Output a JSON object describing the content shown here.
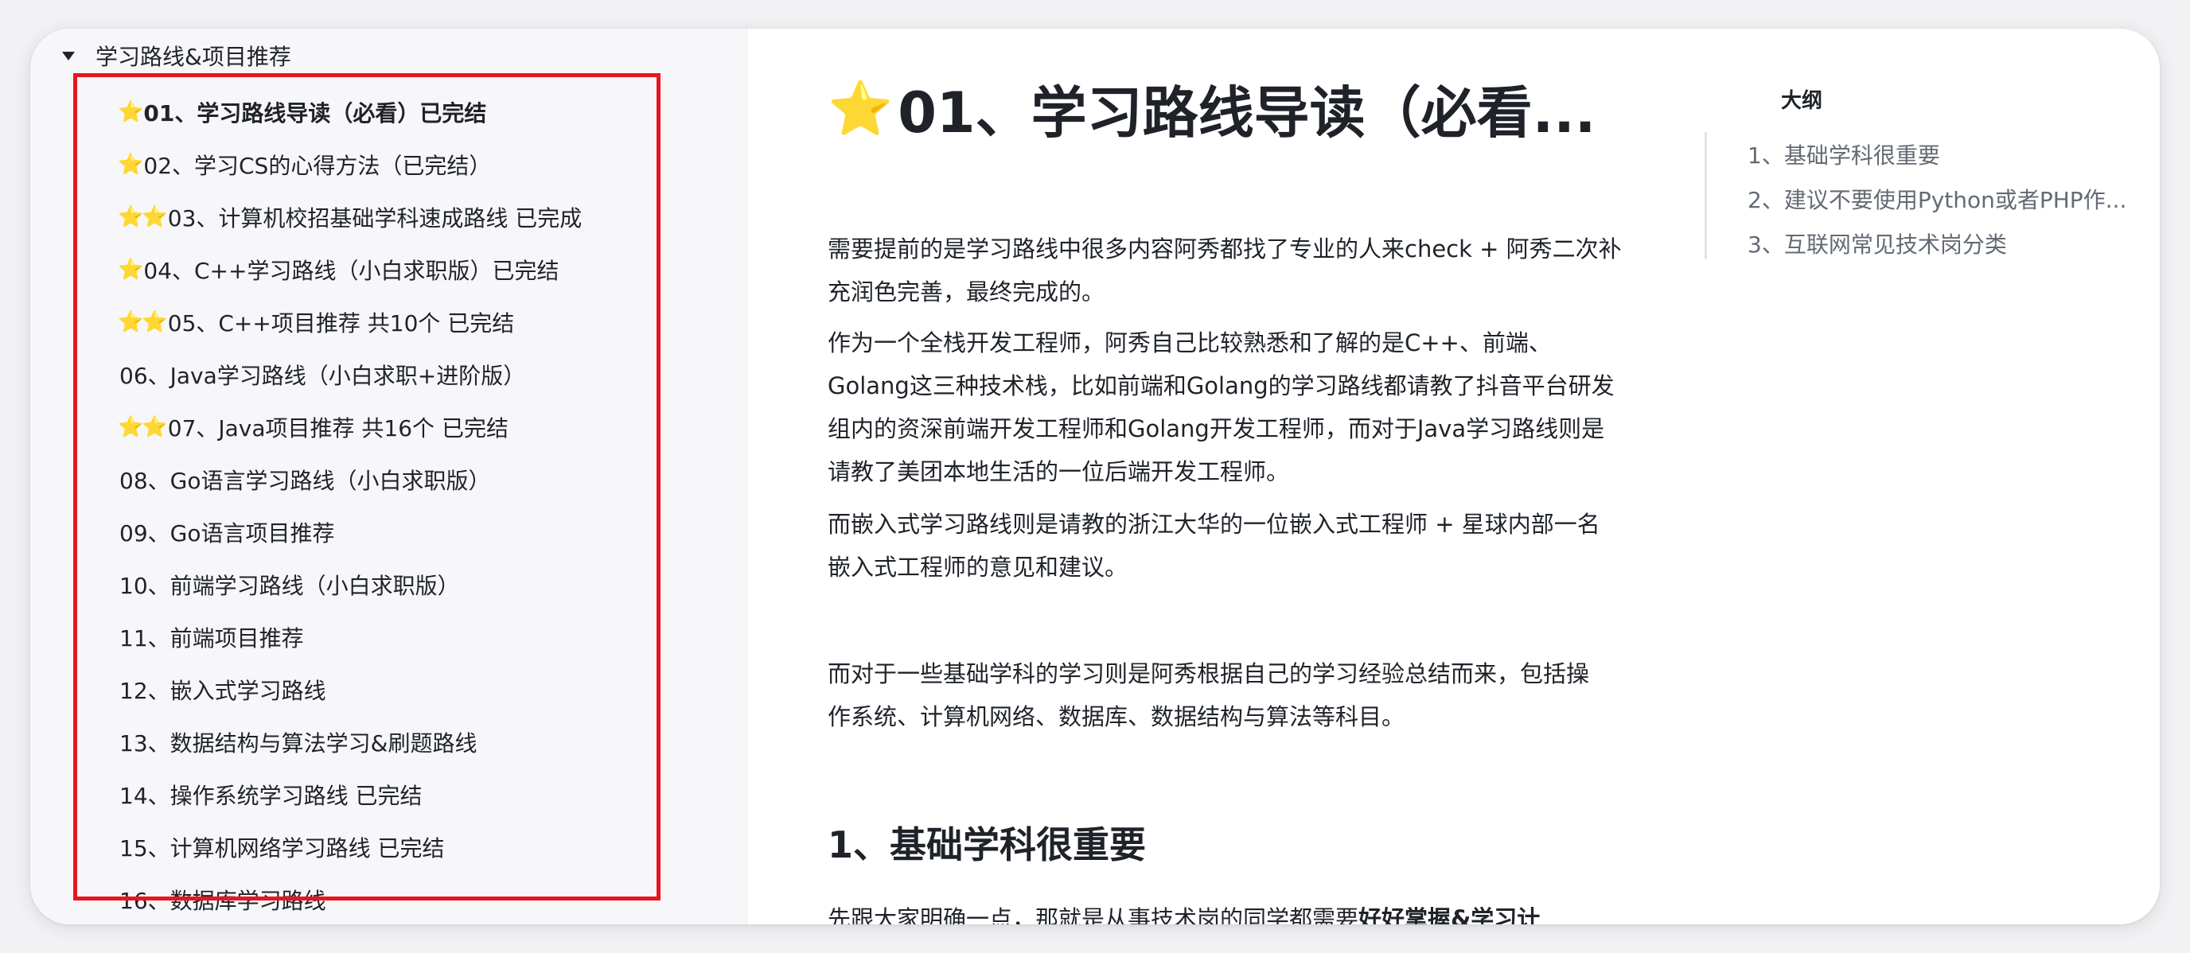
{
  "sidebar": {
    "folder_label": "学习路线&项目推荐",
    "items": [
      {
        "stars": "⭐",
        "label": "01、学习路线导读（必看）已完结",
        "active": true
      },
      {
        "stars": "⭐",
        "label": "02、学习CS的心得方法（已完结）"
      },
      {
        "stars": "⭐⭐",
        "label": "03、计算机校招基础学科速成路线 已完成"
      },
      {
        "stars": "⭐",
        "label": "04、C++学习路线（小白求职版）已完结"
      },
      {
        "stars": "⭐⭐",
        "label": "05、C++项目推荐 共10个 已完结"
      },
      {
        "stars": "",
        "label": "06、Java学习路线（小白求职+进阶版）"
      },
      {
        "stars": "⭐⭐",
        "label": "07、Java项目推荐 共16个 已完结"
      },
      {
        "stars": "",
        "label": "08、Go语言学习路线（小白求职版）"
      },
      {
        "stars": "",
        "label": "09、Go语言项目推荐"
      },
      {
        "stars": "",
        "label": "10、前端学习路线（小白求职版）"
      },
      {
        "stars": "",
        "label": "11、前端项目推荐"
      },
      {
        "stars": "",
        "label": "12、嵌入式学习路线"
      },
      {
        "stars": "",
        "label": "13、数据结构与算法学习&刷题路线"
      },
      {
        "stars": "",
        "label": "14、操作系统学习路线 已完结"
      },
      {
        "stars": "",
        "label": "15、计算机网络学习路线 已完结"
      },
      {
        "stars": "",
        "label": "16、数据库学习路线"
      }
    ]
  },
  "doc": {
    "title_star": "⭐",
    "title": "01、学习路线导读（必看...",
    "paragraphs": [
      [
        "需要提前的是学习路线中很多内容阿秀都找了专业的人来check + 阿秀二次补",
        "充润色完善，最终完成的。"
      ],
      [
        "作为一个全栈开发工程师，阿秀自己比较熟悉和了解的是C++、前端、",
        "Golang这三种技术栈，比如前端和Golang的学习路线都请教了抖音平台研发",
        "组内的资深前端开发工程师和Golang开发工程师，而对于Java学习路线则是",
        "请教了美团本地生活的一位后端开发工程师。"
      ],
      [
        "而嵌入式学习路线则是请教的浙江大华的一位嵌入式工程师 + 星球内部一名",
        "嵌入式工程师的意见和建议。"
      ],
      [
        "而对于一些基础学科的学习则是阿秀根据自己的学习经验总结而来，包括操",
        "作系统、计算机网络、数据库、数据结构与算法等科目。"
      ]
    ],
    "section_heading": "1、基础学科很重要",
    "cut_text_normal": "先跟大家明确一点，那就是从事技术岗的同学都需要",
    "cut_text_bold": "好好掌握&学习计"
  },
  "outline": {
    "title": "大纲",
    "items": [
      "1、基础学科很重要",
      "2、建议不要使用Python或者PHP作...",
      "3、互联网常见技术岗分类"
    ]
  },
  "colors": {
    "highlight_border": "#e8161f",
    "star": "#f6b400",
    "text": "#1f2329",
    "muted_text": "#646a73"
  }
}
